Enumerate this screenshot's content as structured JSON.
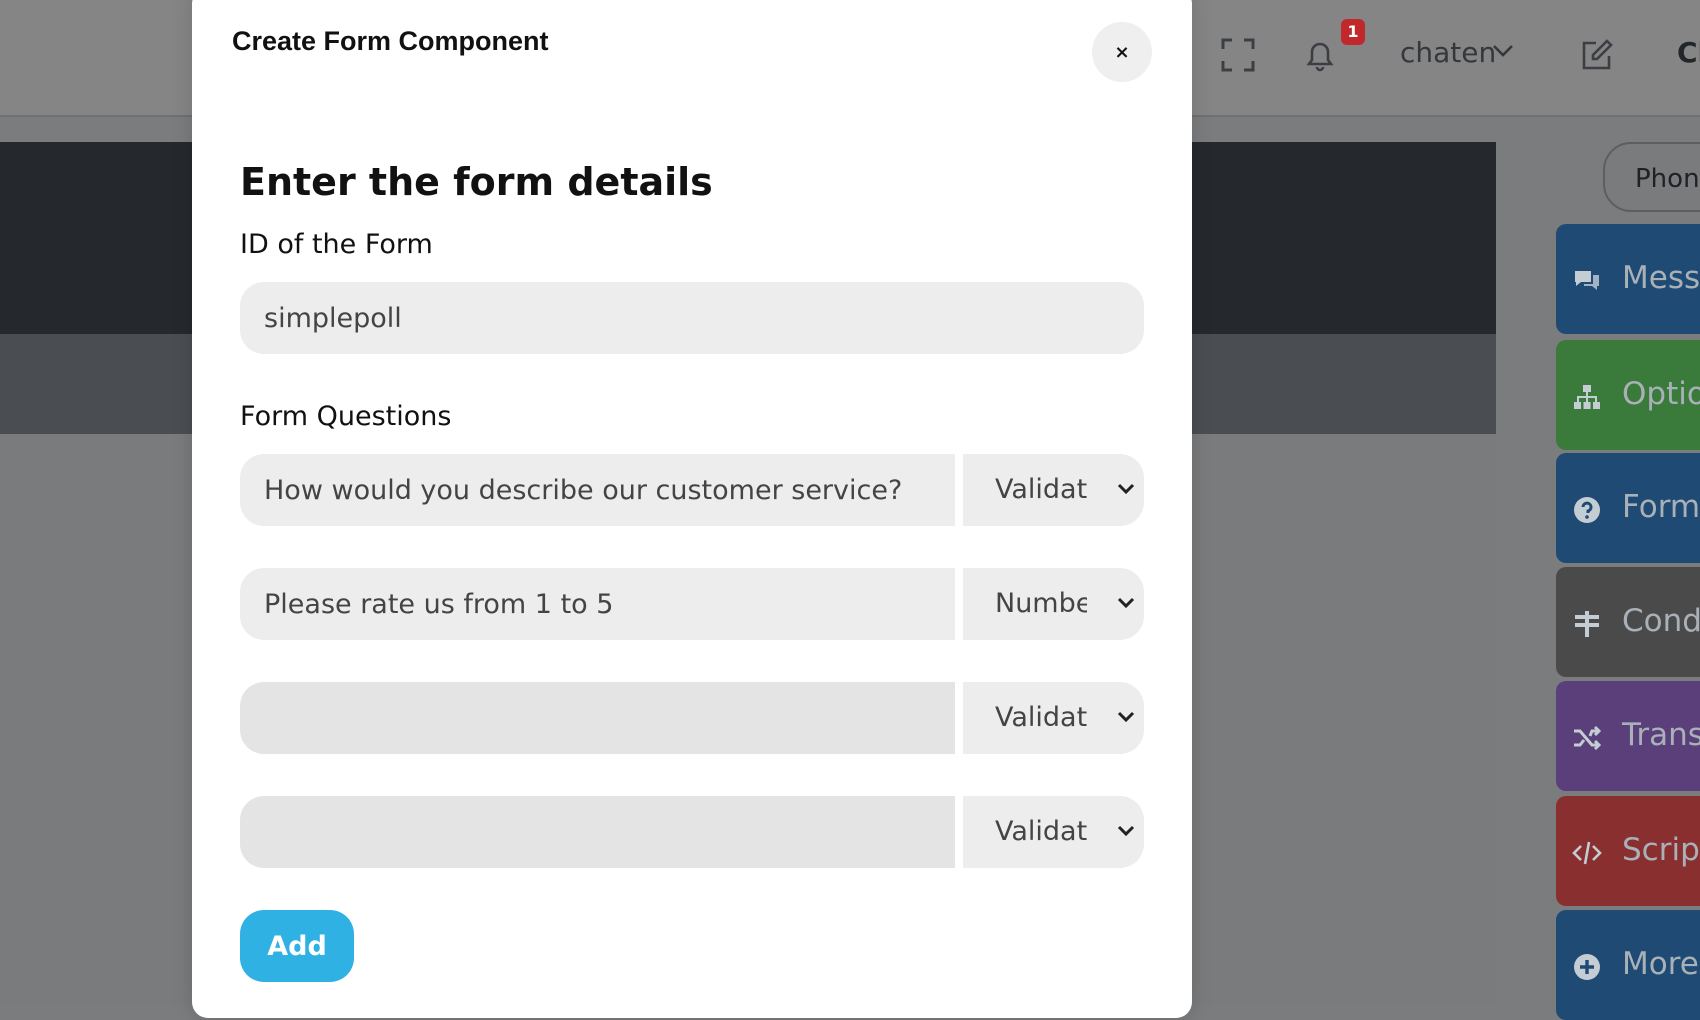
{
  "topbar": {
    "notification_count": "1",
    "user_name": "chaten",
    "cut_title": "Cl"
  },
  "right_panel": {
    "device_label": "Phon",
    "tools": [
      {
        "label": "Messa",
        "icon": "comments-icon",
        "color": "#1e4a73"
      },
      {
        "label": "Optio",
        "icon": "sitemap-icon",
        "color": "#3a7a3a"
      },
      {
        "label": "Form",
        "icon": "question-circle-icon",
        "color": "#1e4a73"
      },
      {
        "label": "Cond",
        "icon": "signpost-icon",
        "color": "#4a4a4a"
      },
      {
        "label": "Trans",
        "icon": "shuffle-icon",
        "color": "#5a3f7a"
      },
      {
        "label": "Scrip",
        "icon": "code-icon",
        "color": "#8a2f2f"
      },
      {
        "label": "More",
        "icon": "plus-circle-icon",
        "color": "#1e4a73"
      }
    ]
  },
  "modal": {
    "title": "Create Form Component",
    "close_label": "×",
    "heading": "Enter the form details",
    "id_label": "ID of the Form",
    "id_value": "simplepoll",
    "questions_label": "Form Questions",
    "questions": [
      {
        "text": "How would you describe our customer service?",
        "type": "Validate"
      },
      {
        "text": "Please rate us from 1 to 5",
        "type": "Number"
      },
      {
        "text": "",
        "type": "Validate"
      },
      {
        "text": "",
        "type": "Validate"
      }
    ],
    "add_label": "Add"
  }
}
